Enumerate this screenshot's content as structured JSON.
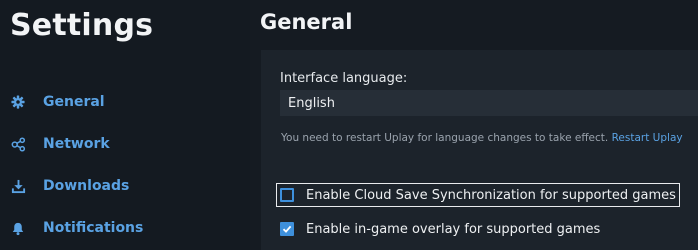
{
  "sidebar": {
    "title": "Settings",
    "items": [
      {
        "label": "General",
        "icon": "gear-icon"
      },
      {
        "label": "Network",
        "icon": "network-icon"
      },
      {
        "label": "Downloads",
        "icon": "download-icon"
      },
      {
        "label": "Notifications",
        "icon": "bell-icon"
      }
    ]
  },
  "main": {
    "title": "General",
    "language": {
      "label": "Interface language:",
      "value": "English",
      "note": "You need to restart Uplay for language changes to take effect.",
      "restart_link": "Restart Uplay"
    },
    "options": [
      {
        "label": "Enable Cloud Save Synchronization for supported games",
        "checked": false
      },
      {
        "label": "Enable in-game overlay for supported games",
        "checked": true
      }
    ]
  },
  "colors": {
    "accent": "#5aa2e3",
    "checkbox": "#3e90dc",
    "background": "#141a21",
    "panel": "#1c232b"
  }
}
